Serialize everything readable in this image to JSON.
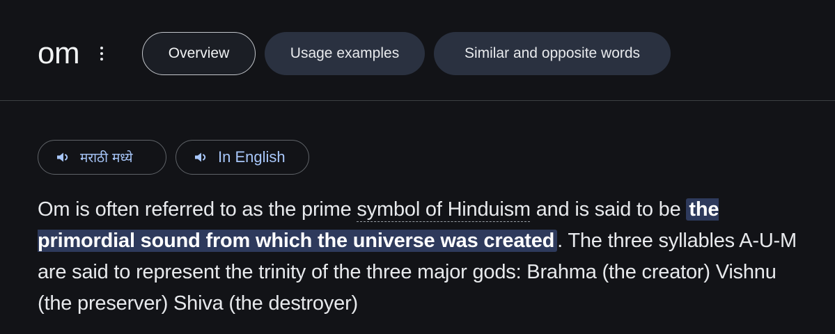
{
  "header": {
    "term": "om",
    "tabs": [
      {
        "label": "Overview",
        "active": true
      },
      {
        "label": "Usage examples",
        "active": false
      },
      {
        "label": "Similar and opposite words",
        "active": false
      }
    ]
  },
  "pronunciation": {
    "buttons": [
      {
        "label": "मराठी मध्ये",
        "icon": "speaker-icon"
      },
      {
        "label": "In English",
        "icon": "speaker-icon"
      }
    ]
  },
  "definition": {
    "part1": "Om is often referred to as the prime ",
    "link": "symbol of Hinduism",
    "part2": " and is said to be ",
    "highlight": "the primordial sound from which the universe was created",
    "part3": ". The three syllables A-U-M are said to represent the trinity of the three major gods: Brahma (the creator) Vishnu (the preserver) Shiva (the destroyer)"
  },
  "colors": {
    "background": "#121317",
    "tab_fill": "#2a3140",
    "accent_text": "#a8c7fa",
    "highlight_bg": "#2e3a5c"
  }
}
